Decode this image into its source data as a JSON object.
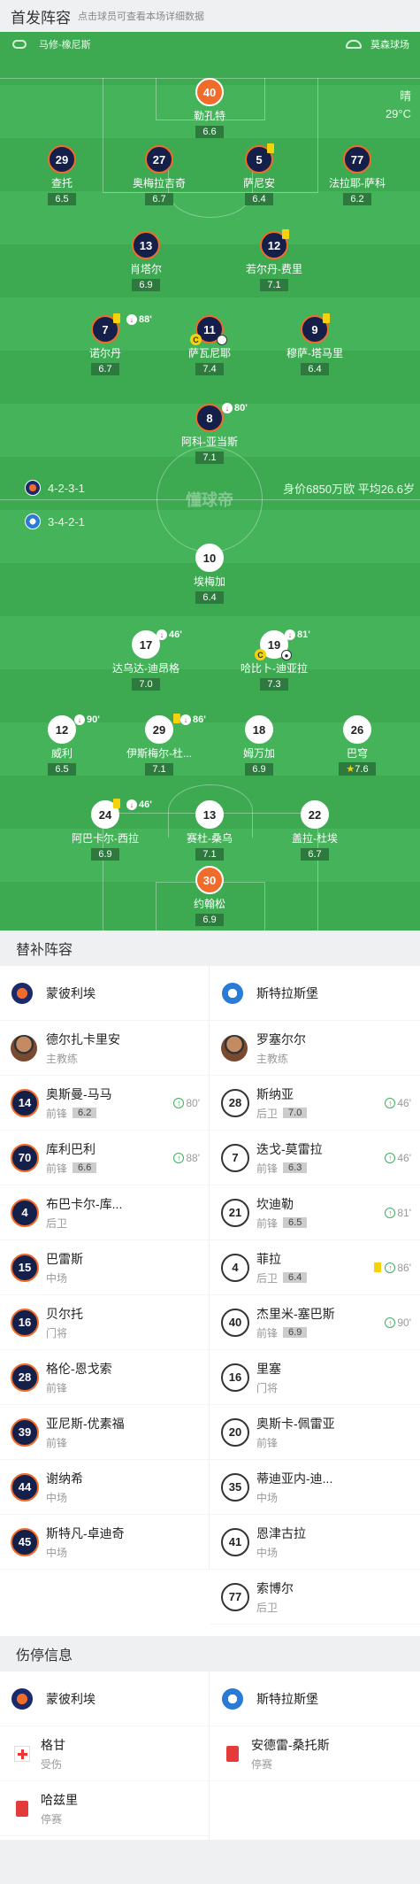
{
  "header": {
    "title": "首发阵容",
    "subtitle": "点击球员可查看本场详细数据"
  },
  "venue": {
    "home_team": "马修-橡尼斯",
    "stadium": "莫森球场"
  },
  "weather": {
    "condition": "晴",
    "temperature": "29°C"
  },
  "colors": {
    "pitch": "#44b35a",
    "home_badge": "#15204a",
    "home_border": "#f16b2a",
    "captain": "#f16b2a"
  },
  "formations": {
    "home": "4-2-3-1",
    "away": "3-4-2-1"
  },
  "team_info": "身价6850万欧 平均26.6岁",
  "watermark": "懂球帝",
  "home_lineup": [
    {
      "num": "40",
      "name": "勒孔特",
      "rating": "6.6"
    },
    {
      "num": "29",
      "name": "查托",
      "rating": "6.5"
    },
    {
      "num": "27",
      "name": "奥梅拉吉奇",
      "rating": "6.7"
    },
    {
      "num": "5",
      "name": "萨尼安",
      "rating": "6.4"
    },
    {
      "num": "77",
      "name": "法拉耶-萨科",
      "rating": "6.2"
    },
    {
      "num": "13",
      "name": "肖塔尔",
      "rating": "6.9"
    },
    {
      "num": "12",
      "name": "若尔丹-费里",
      "rating": "7.1"
    },
    {
      "num": "7",
      "name": "诺尔丹",
      "rating": "6.7",
      "sub": "88'"
    },
    {
      "num": "11",
      "name": "萨瓦尼耶",
      "rating": "7.4"
    },
    {
      "num": "9",
      "name": "穆萨-塔马里",
      "rating": "6.4"
    },
    {
      "num": "8",
      "name": "阿科-亚当斯",
      "rating": "7.1",
      "sub": "80'"
    }
  ],
  "away_lineup": [
    {
      "num": "10",
      "name": "埃梅加",
      "rating": "6.4"
    },
    {
      "num": "17",
      "name": "达乌达-迪昂格",
      "rating": "7.0",
      "sub": "46'"
    },
    {
      "num": "19",
      "name": "哈比卜-迪亚拉",
      "rating": "7.3",
      "sub": "81'"
    },
    {
      "num": "12",
      "name": "威利",
      "rating": "6.5",
      "sub": "90'"
    },
    {
      "num": "29",
      "name": "伊斯梅尔-杜...",
      "rating": "7.1",
      "sub": "86'"
    },
    {
      "num": "18",
      "name": "姆万加",
      "rating": "6.9"
    },
    {
      "num": "26",
      "name": "巴穹",
      "rating": "7.6"
    },
    {
      "num": "24",
      "name": "阿巴卡尔-西拉",
      "rating": "6.9",
      "sub": "46'"
    },
    {
      "num": "13",
      "name": "赛杜-桑乌",
      "rating": "7.1"
    },
    {
      "num": "22",
      "name": "盖拉-杜埃",
      "rating": "6.7"
    },
    {
      "num": "30",
      "name": "约翰松",
      "rating": "6.9"
    }
  ],
  "subs_title": "替补阵容",
  "subs": {
    "home_team": "蒙彼利埃",
    "away_team": "斯特拉斯堡",
    "home_coach": {
      "name": "德尔扎卡里安",
      "role": "主教练"
    },
    "away_coach": {
      "name": "罗塞尔尔",
      "role": "主教练"
    },
    "home": [
      {
        "num": "14",
        "name": "奥斯曼-马马",
        "pos": "前锋",
        "rating": "6.2",
        "time": "80'"
      },
      {
        "num": "70",
        "name": "库利巴利",
        "pos": "前锋",
        "rating": "6.6",
        "time": "88'"
      },
      {
        "num": "4",
        "name": "布巴卡尔-库...",
        "pos": "后卫"
      },
      {
        "num": "15",
        "name": "巴雷斯",
        "pos": "中场"
      },
      {
        "num": "16",
        "name": "贝尔托",
        "pos": "门将"
      },
      {
        "num": "28",
        "name": "格伦-恩戈索",
        "pos": "前锋"
      },
      {
        "num": "39",
        "name": "亚尼斯-优素福",
        "pos": "前锋"
      },
      {
        "num": "44",
        "name": "谢纳希",
        "pos": "中场"
      },
      {
        "num": "45",
        "name": "斯特凡-卓迪奇",
        "pos": "中场"
      }
    ],
    "away": [
      {
        "num": "28",
        "name": "斯纳亚",
        "pos": "后卫",
        "rating": "7.0",
        "time": "46'"
      },
      {
        "num": "7",
        "name": "迭戈-莫雷拉",
        "pos": "前锋",
        "rating": "6.3",
        "time": "46'"
      },
      {
        "num": "21",
        "name": "坎迪勒",
        "pos": "前锋",
        "rating": "6.5",
        "time": "81'"
      },
      {
        "num": "4",
        "name": "菲拉",
        "pos": "后卫",
        "rating": "6.4",
        "time": "86'"
      },
      {
        "num": "40",
        "name": "杰里米-塞巴斯",
        "pos": "前锋",
        "rating": "6.9",
        "time": "90'"
      },
      {
        "num": "16",
        "name": "里塞",
        "pos": "门将"
      },
      {
        "num": "20",
        "name": "奥斯卡-佩雷亚",
        "pos": "前锋"
      },
      {
        "num": "35",
        "name": "蒂迪亚内-迪...",
        "pos": "中场"
      },
      {
        "num": "41",
        "name": "恩津古拉",
        "pos": "中场"
      },
      {
        "num": "77",
        "name": "索博尔",
        "pos": "后卫"
      }
    ]
  },
  "injuries_title": "伤停信息",
  "injuries": {
    "home": [
      {
        "name": "格甘",
        "status": "受伤"
      },
      {
        "name": "哈兹里",
        "status": "停赛"
      }
    ],
    "away": [
      {
        "name": "安德雷-桑托斯",
        "status": "停赛"
      }
    ]
  }
}
